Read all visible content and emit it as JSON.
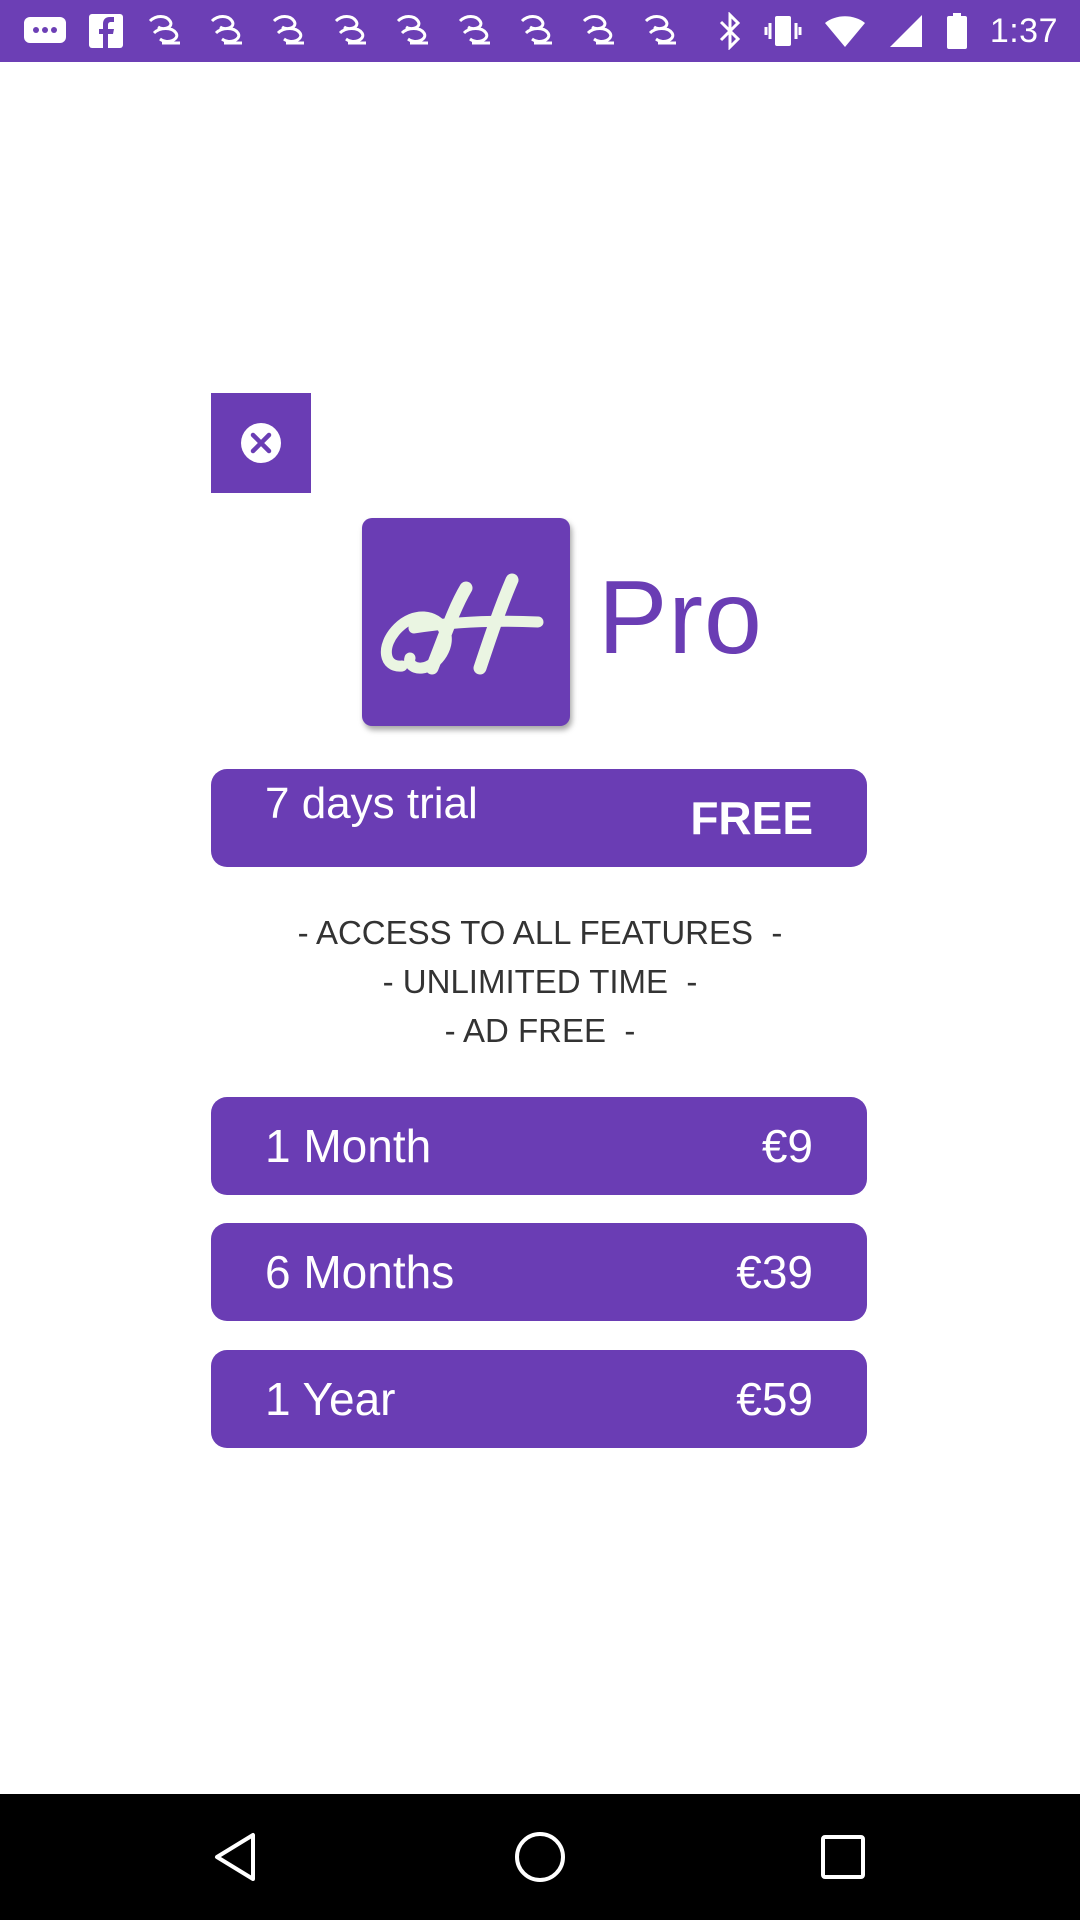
{
  "status_bar": {
    "time": "1:37",
    "left_icons": [
      "messages-icon",
      "facebook-icon",
      "app-icon",
      "app-icon",
      "app-icon",
      "app-icon",
      "app-icon",
      "app-icon",
      "app-icon",
      "app-icon",
      "app-icon"
    ],
    "right_icons": [
      "bluetooth-icon",
      "vibrate-icon",
      "wifi-icon",
      "signal-icon",
      "battery-icon"
    ]
  },
  "logo": {
    "suffix": "Pro"
  },
  "trial": {
    "label": "7 days trial",
    "price": "FREE"
  },
  "features": [
    "- ACCESS TO ALL FEATURES  -",
    "- UNLIMITED TIME  -",
    "- AD FREE  -"
  ],
  "plans": [
    {
      "label": "1 Month",
      "price": "€9"
    },
    {
      "label": "6 Months",
      "price": "€39"
    },
    {
      "label": "1 Year",
      "price": "€59"
    }
  ],
  "colors": {
    "accent": "#6a3db4",
    "status_bar": "#6c3fb5",
    "logo_glyph": "#eaf5e2"
  }
}
